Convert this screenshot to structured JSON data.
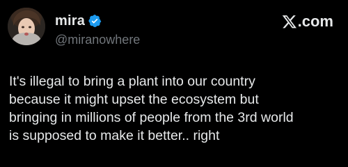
{
  "author": {
    "display_name": "mira",
    "handle": "@miranowhere",
    "verified": true,
    "avatar_icon": "profile-photo"
  },
  "brand": {
    "label": ".com",
    "icon": "x-logo-icon"
  },
  "post": {
    "text": "It's illegal to bring a plant into our country\nbecause it might upset the ecosystem but\nbringing in millions of people from the 3rd world\nis supposed to make it better.. right"
  },
  "colors": {
    "background": "#000000",
    "text_primary": "#e7e9ea",
    "text_secondary": "#71767b",
    "verified_badge": "#1d9bf0"
  }
}
